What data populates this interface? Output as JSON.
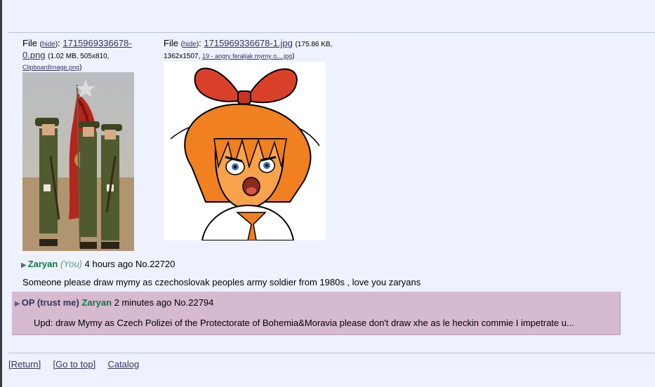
{
  "files": [
    {
      "label": "File ",
      "hide": "hide",
      "filename_line1": "1715969336678-",
      "filename_line2": "0.png",
      "meta": "(1.02 MB, 505x810,",
      "original": "ClipboardImage.png",
      "meta_end": ")"
    },
    {
      "label": "File ",
      "hide": "hide",
      "filename": "1715969336678-1.jpg",
      "meta1": "(175.86 KB,",
      "meta2": "1362x1507, ",
      "original": "19 - angry feraljak mymy o....jpg",
      "meta_end": ")"
    }
  ],
  "post": {
    "name": "Zaryan",
    "you": "(You)",
    "time": "4 hours ago",
    "number": "No.22720",
    "comment": "Someone please draw mymy as czechoslovak peoples army soldier from 1980s , love you zaryans"
  },
  "reply": {
    "op": "OP (trust me)",
    "name": "Zaryan",
    "time": "2 minutes ago",
    "number": "No.22794",
    "comment": "Upd: draw Mymy as Czech Polizei of the Protectorate of Bohemia&Moravia please don't draw xhe as le heckin commie I impetrate u..."
  },
  "nav": {
    "return": "[Return]",
    "top": "[Go to top]",
    "catalog": "Catalog"
  },
  "icons": {
    "post_arrow": "triangle-right-icon"
  }
}
